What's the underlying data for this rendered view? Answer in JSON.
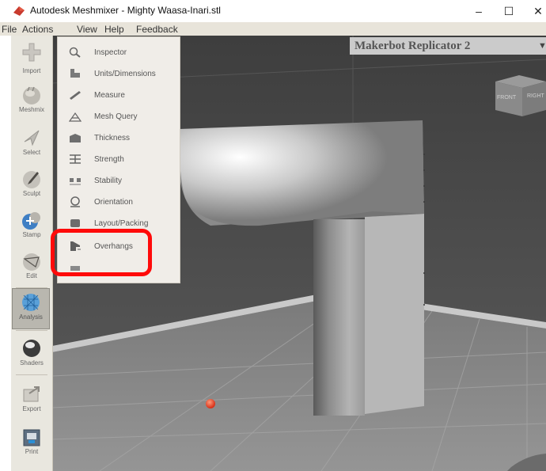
{
  "window": {
    "title": "Autodesk Meshmixer - Mighty Waasa-Inari.stl",
    "minimize": "–",
    "maximize": "☐",
    "close": "✕"
  },
  "menubar": [
    "File",
    "Actions",
    "View",
    "Help",
    "Feedback"
  ],
  "toolbar": [
    {
      "label": "Import",
      "icon": "plus-icon"
    },
    {
      "label": "Meshmix",
      "icon": "bunny-icon"
    },
    {
      "label": "Select",
      "icon": "arrow-icon"
    },
    {
      "label": "Sculpt",
      "icon": "brush-icon"
    },
    {
      "label": "Stamp",
      "icon": "stamp-icon"
    },
    {
      "label": "Edit",
      "icon": "edit-icon"
    },
    {
      "label": "Analysis",
      "icon": "analysis-icon",
      "active": true
    },
    {
      "label": "Shaders",
      "icon": "sphere-icon"
    },
    {
      "label": "Export",
      "icon": "export-icon"
    },
    {
      "label": "Print",
      "icon": "printer-icon"
    }
  ],
  "printer": {
    "name": "Makerbot Replicator 2",
    "dropdown": "▼"
  },
  "navcube": {
    "front": "FRONT",
    "right": "RIGHT"
  },
  "analysis_menu": [
    {
      "label": "Inspector",
      "icon": "magnifier-icon"
    },
    {
      "label": "Units/Dimensions",
      "icon": "ruler-box-icon"
    },
    {
      "label": "Measure",
      "icon": "measure-icon"
    },
    {
      "label": "Mesh Query",
      "icon": "mesh-query-icon"
    },
    {
      "label": "Thickness",
      "icon": "thickness-icon"
    },
    {
      "label": "Strength",
      "icon": "strength-icon"
    },
    {
      "label": "Stability",
      "icon": "stability-icon"
    },
    {
      "label": "Orientation",
      "icon": "orientation-icon"
    },
    {
      "label": "Layout/Packing",
      "icon": "layout-icon"
    },
    {
      "label": "Overhangs",
      "icon": "overhangs-icon",
      "highlighted": true
    }
  ],
  "colors": {
    "highlight": "#ff0a0a",
    "viewport": "#4a4a4a",
    "toolbar": "#e9e7df"
  }
}
